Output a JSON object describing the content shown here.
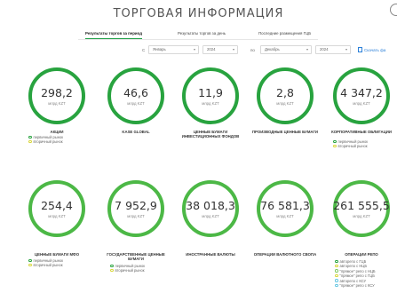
{
  "header": {
    "title": "ТОРГОВАЯ ИНФОРМАЦИЯ"
  },
  "tabs": [
    {
      "label": "Результаты торгов за период",
      "active": true
    },
    {
      "label": "Результаты торгов за день",
      "active": false
    },
    {
      "label": "Последние размещения ГЦБ",
      "active": false
    }
  ],
  "filters": {
    "from_label": "С",
    "from_month": "Январь",
    "from_year": "2024",
    "to_label": "по",
    "to_month": "Декабрь",
    "to_year": "2024",
    "download_label": "Скачать фа"
  },
  "colors": {
    "ring": "#28a33f",
    "primary_market": "#28a33f",
    "secondary_market": "#d8d63a",
    "link": "#2a7fd8"
  },
  "cards": [
    {
      "value": "298,2",
      "unit": "млрд KZT",
      "caption": "АКЦИИ",
      "legend": [
        "первичный рынок",
        "вторичный рынок"
      ]
    },
    {
      "value": "46,6",
      "unit": "млрд KZT",
      "caption": "KASE GLOBAL",
      "legend": []
    },
    {
      "value": "11,9",
      "unit": "млрд KZT",
      "caption": "ЦЕННЫЕ БУМАГИ ИНВЕСТИЦИОННЫХ ФОНДОВ",
      "legend": []
    },
    {
      "value": "2,8",
      "unit": "млрд KZT",
      "caption": "ПРОИЗВОДНЫЕ ЦЕННЫЕ БУМАГИ",
      "legend": []
    },
    {
      "value": "4 347,2",
      "unit": "млрд KZT",
      "caption": "КОРПОРАТИВНЫЕ ОБЛИГАЦИИ",
      "legend": [
        "первичный рынок",
        "вторичный рынок"
      ]
    },
    {
      "value": "254,4",
      "unit": "млрд KZT",
      "caption": "ЦЕННЫЕ БУМАГИ МФО",
      "legend": [
        "первичный рынок",
        "вторичный рынок"
      ]
    },
    {
      "value": "7 952,9",
      "unit": "млрд KZT",
      "caption": "ГОСУДАРСТВЕННЫЕ ЦЕННЫЕ БУМАГИ",
      "legend": [
        "первичный рынок",
        "вторичный рынок"
      ]
    },
    {
      "value": "38 018,3",
      "unit": "млрд KZT",
      "caption": "ИНОСТРАННЫЕ ВАЛЮТЫ",
      "legend": []
    },
    {
      "value": "76 581,3",
      "unit": "млрд KZT",
      "caption": "ОПЕРАЦИИ ВАЛЮТНОГО СВОПА",
      "legend": []
    },
    {
      "value": "261 555,5",
      "unit": "млрд KZT",
      "caption": "ОПЕРАЦИИ РЕПО",
      "legend": [
        "авторепо с ГЦБ",
        "авторепо с НЦБ",
        "\"прямое\" репо с НЦБ",
        "\"прямое\" репо с ГЦБ",
        "авторепо с КСУ",
        "\"прямое\" репо с КСУ"
      ]
    }
  ]
}
